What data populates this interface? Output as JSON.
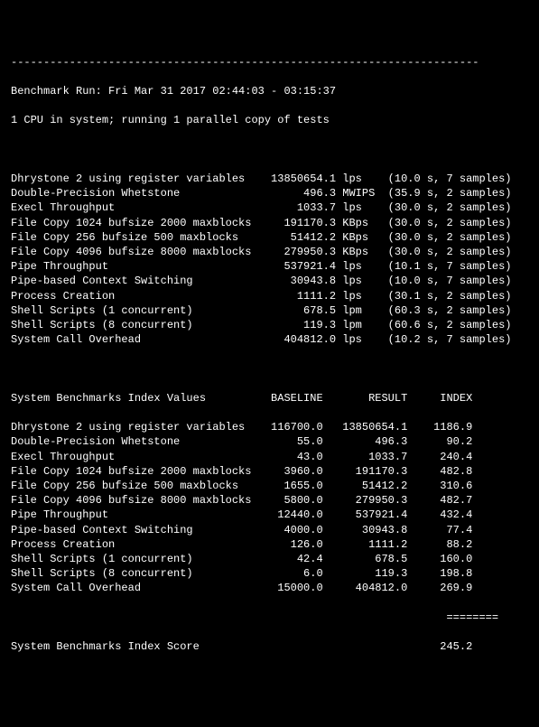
{
  "header": {
    "sep_top": "------------------------------------------------------------------------",
    "run_line": "Benchmark Run: Fri Mar 31 2017 02:44:03 - 03:15:37",
    "cpu_line": "1 CPU in system; running 1 parallel copy of tests"
  },
  "tests": [
    {
      "name": "Dhrystone 2 using register variables",
      "value": "13850654.1",
      "unit": "lps",
      "time": "10.0",
      "samples": "7"
    },
    {
      "name": "Double-Precision Whetstone",
      "value": "496.3",
      "unit": "MWIPS",
      "time": "35.9",
      "samples": "2"
    },
    {
      "name": "Execl Throughput",
      "value": "1033.7",
      "unit": "lps",
      "time": "30.0",
      "samples": "2"
    },
    {
      "name": "File Copy 1024 bufsize 2000 maxblocks",
      "value": "191170.3",
      "unit": "KBps",
      "time": "30.0",
      "samples": "2"
    },
    {
      "name": "File Copy 256 bufsize 500 maxblocks",
      "value": "51412.2",
      "unit": "KBps",
      "time": "30.0",
      "samples": "2"
    },
    {
      "name": "File Copy 4096 bufsize 8000 maxblocks",
      "value": "279950.3",
      "unit": "KBps",
      "time": "30.0",
      "samples": "2"
    },
    {
      "name": "Pipe Throughput",
      "value": "537921.4",
      "unit": "lps",
      "time": "10.1",
      "samples": "7"
    },
    {
      "name": "Pipe-based Context Switching",
      "value": "30943.8",
      "unit": "lps",
      "time": "10.0",
      "samples": "7"
    },
    {
      "name": "Process Creation",
      "value": "1111.2",
      "unit": "lps",
      "time": "30.1",
      "samples": "2"
    },
    {
      "name": "Shell Scripts (1 concurrent)",
      "value": "678.5",
      "unit": "lpm",
      "time": "60.3",
      "samples": "2"
    },
    {
      "name": "Shell Scripts (8 concurrent)",
      "value": "119.3",
      "unit": "lpm",
      "time": "60.6",
      "samples": "2"
    },
    {
      "name": "System Call Overhead",
      "value": "404812.0",
      "unit": "lps",
      "time": "10.2",
      "samples": "7"
    }
  ],
  "index_header": {
    "title": "System Benchmarks Index Values",
    "col_baseline": "BASELINE",
    "col_result": "RESULT",
    "col_index": "INDEX"
  },
  "indexes": [
    {
      "name": "Dhrystone 2 using register variables",
      "baseline": "116700.0",
      "result": "13850654.1",
      "index": "1186.9"
    },
    {
      "name": "Double-Precision Whetstone",
      "baseline": "55.0",
      "result": "496.3",
      "index": "90.2"
    },
    {
      "name": "Execl Throughput",
      "baseline": "43.0",
      "result": "1033.7",
      "index": "240.4"
    },
    {
      "name": "File Copy 1024 bufsize 2000 maxblocks",
      "baseline": "3960.0",
      "result": "191170.3",
      "index": "482.8"
    },
    {
      "name": "File Copy 256 bufsize 500 maxblocks",
      "baseline": "1655.0",
      "result": "51412.2",
      "index": "310.6"
    },
    {
      "name": "File Copy 4096 bufsize 8000 maxblocks",
      "baseline": "5800.0",
      "result": "279950.3",
      "index": "482.7"
    },
    {
      "name": "Pipe Throughput",
      "baseline": "12440.0",
      "result": "537921.4",
      "index": "432.4"
    },
    {
      "name": "Pipe-based Context Switching",
      "baseline": "4000.0",
      "result": "30943.8",
      "index": "77.4"
    },
    {
      "name": "Process Creation",
      "baseline": "126.0",
      "result": "1111.2",
      "index": "88.2"
    },
    {
      "name": "Shell Scripts (1 concurrent)",
      "baseline": "42.4",
      "result": "678.5",
      "index": "160.0"
    },
    {
      "name": "Shell Scripts (8 concurrent)",
      "baseline": "6.0",
      "result": "119.3",
      "index": "198.8"
    },
    {
      "name": "System Call Overhead",
      "baseline": "15000.0",
      "result": "404812.0",
      "index": "269.9"
    }
  ],
  "footer": {
    "sep": "                                                                   ========",
    "label": "System Benchmarks Index Score",
    "score": "245.2"
  },
  "chart_data": {
    "type": "table",
    "title": "UnixBench System Benchmarks",
    "series": [
      {
        "name": "Dhrystone 2 using register variables",
        "baseline": 116700.0,
        "result": 13850654.1,
        "index": 1186.9
      },
      {
        "name": "Double-Precision Whetstone",
        "baseline": 55.0,
        "result": 496.3,
        "index": 90.2
      },
      {
        "name": "Execl Throughput",
        "baseline": 43.0,
        "result": 1033.7,
        "index": 240.4
      },
      {
        "name": "File Copy 1024 bufsize 2000 maxblocks",
        "baseline": 3960.0,
        "result": 191170.3,
        "index": 482.8
      },
      {
        "name": "File Copy 256 bufsize 500 maxblocks",
        "baseline": 1655.0,
        "result": 51412.2,
        "index": 310.6
      },
      {
        "name": "File Copy 4096 bufsize 8000 maxblocks",
        "baseline": 5800.0,
        "result": 279950.3,
        "index": 482.7
      },
      {
        "name": "Pipe Throughput",
        "baseline": 12440.0,
        "result": 537921.4,
        "index": 432.4
      },
      {
        "name": "Pipe-based Context Switching",
        "baseline": 4000.0,
        "result": 30943.8,
        "index": 77.4
      },
      {
        "name": "Process Creation",
        "baseline": 126.0,
        "result": 1111.2,
        "index": 88.2
      },
      {
        "name": "Shell Scripts (1 concurrent)",
        "baseline": 42.4,
        "result": 678.5,
        "index": 160.0
      },
      {
        "name": "Shell Scripts (8 concurrent)",
        "baseline": 6.0,
        "result": 119.3,
        "index": 198.8
      },
      {
        "name": "System Call Overhead",
        "baseline": 15000.0,
        "result": 404812.0,
        "index": 269.9
      }
    ],
    "overall_index_score": 245.2
  }
}
